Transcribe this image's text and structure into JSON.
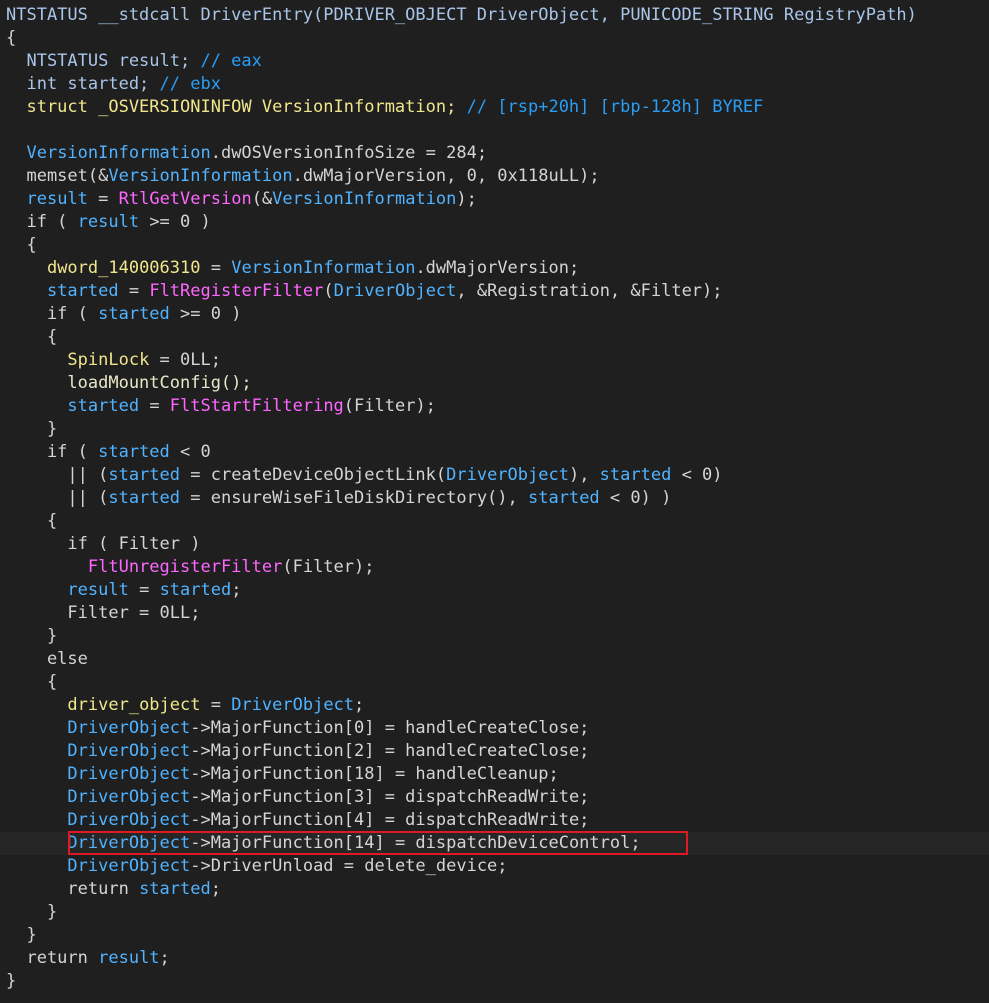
{
  "colors": {
    "background": "#1f1f1f",
    "current_line": "#262626",
    "highlight_border": "#e01a22",
    "default": "#d4d4d4",
    "type": "#a9c5e8",
    "variable": "#51b3ff",
    "lvar": "#f0e68c",
    "import": "#ff66ff",
    "comment": "#2a9df4",
    "function": "#e8e8c8"
  },
  "code": {
    "lines": [
      [
        [
          "NTSTATUS __stdcall DriverEntry(PDRIVER_OBJECT DriverObject, PUNICODE_STRING RegistryPath)",
          "type"
        ]
      ],
      [
        [
          "{",
          "default"
        ]
      ],
      [
        [
          "  NTSTATUS result; ",
          "type"
        ],
        [
          "// eax",
          "comment"
        ]
      ],
      [
        [
          "  int started; ",
          "type"
        ],
        [
          "// ebx",
          "comment"
        ]
      ],
      [
        [
          "  struct _OSVERSIONINFOW VersionInformation; ",
          "lvar"
        ],
        [
          "// [rsp+20h] [rbp-128h] BYREF",
          "comment"
        ]
      ],
      [
        [
          "",
          "default"
        ]
      ],
      [
        [
          "  ",
          "default"
        ],
        [
          "VersionInformation",
          "variable"
        ],
        [
          ".dwOSVersionInfoSize = 284;",
          "default"
        ]
      ],
      [
        [
          "  memset(&",
          "default"
        ],
        [
          "VersionInformation",
          "variable"
        ],
        [
          ".dwMajorVersion, 0, 0x118uLL);",
          "default"
        ]
      ],
      [
        [
          "  ",
          "default"
        ],
        [
          "result",
          "variable"
        ],
        [
          " = ",
          "default"
        ],
        [
          "RtlGetVersion",
          "import"
        ],
        [
          "(&",
          "default"
        ],
        [
          "VersionInformation",
          "variable"
        ],
        [
          ");",
          "default"
        ]
      ],
      [
        [
          "  if ( ",
          "default"
        ],
        [
          "result",
          "variable"
        ],
        [
          " >= 0 )",
          "default"
        ]
      ],
      [
        [
          "  {",
          "default"
        ]
      ],
      [
        [
          "    ",
          "default"
        ],
        [
          "dword_140006310",
          "lvar"
        ],
        [
          " = ",
          "default"
        ],
        [
          "VersionInformation",
          "variable"
        ],
        [
          ".dwMajorVersion;",
          "default"
        ]
      ],
      [
        [
          "    ",
          "default"
        ],
        [
          "started",
          "variable"
        ],
        [
          " = ",
          "default"
        ],
        [
          "FltRegisterFilter",
          "import"
        ],
        [
          "(",
          "default"
        ],
        [
          "DriverObject",
          "variable"
        ],
        [
          ", &Registration, &Filter);",
          "default"
        ]
      ],
      [
        [
          "    if ( ",
          "default"
        ],
        [
          "started",
          "variable"
        ],
        [
          " >= 0 )",
          "default"
        ]
      ],
      [
        [
          "    {",
          "default"
        ]
      ],
      [
        [
          "      ",
          "default"
        ],
        [
          "SpinLock",
          "lvar"
        ],
        [
          " = 0LL;",
          "default"
        ]
      ],
      [
        [
          "      loadMountConfig();",
          "function"
        ]
      ],
      [
        [
          "      ",
          "default"
        ],
        [
          "started",
          "variable"
        ],
        [
          " = ",
          "default"
        ],
        [
          "FltStartFiltering",
          "import"
        ],
        [
          "(Filter);",
          "default"
        ]
      ],
      [
        [
          "    }",
          "default"
        ]
      ],
      [
        [
          "    if ( ",
          "default"
        ],
        [
          "started",
          "variable"
        ],
        [
          " < 0",
          "default"
        ]
      ],
      [
        [
          "      || (",
          "default"
        ],
        [
          "started",
          "variable"
        ],
        [
          " = createDeviceObjectLink(",
          "default"
        ],
        [
          "DriverObject",
          "variable"
        ],
        [
          "), ",
          "default"
        ],
        [
          "started",
          "variable"
        ],
        [
          " < 0)",
          "default"
        ]
      ],
      [
        [
          "      || (",
          "default"
        ],
        [
          "started",
          "variable"
        ],
        [
          " = ensureWiseFileDiskDirectory(), ",
          "default"
        ],
        [
          "started",
          "variable"
        ],
        [
          " < 0) )",
          "default"
        ]
      ],
      [
        [
          "    {",
          "default"
        ]
      ],
      [
        [
          "      if ( Filter )",
          "default"
        ]
      ],
      [
        [
          "        ",
          "default"
        ],
        [
          "FltUnregisterFilter",
          "import"
        ],
        [
          "(Filter);",
          "default"
        ]
      ],
      [
        [
          "      ",
          "default"
        ],
        [
          "result",
          "variable"
        ],
        [
          " = ",
          "default"
        ],
        [
          "started",
          "variable"
        ],
        [
          ";",
          "default"
        ]
      ],
      [
        [
          "      Filter = 0LL;",
          "default"
        ]
      ],
      [
        [
          "    }",
          "default"
        ]
      ],
      [
        [
          "    else",
          "default"
        ]
      ],
      [
        [
          "    {",
          "default"
        ]
      ],
      [
        [
          "      ",
          "default"
        ],
        [
          "driver_object",
          "lvar"
        ],
        [
          " = ",
          "default"
        ],
        [
          "DriverObject",
          "variable"
        ],
        [
          ";",
          "default"
        ]
      ],
      [
        [
          "      ",
          "default"
        ],
        [
          "DriverObject",
          "variable"
        ],
        [
          "->MajorFunction[0] = handleCreateClose;",
          "default"
        ]
      ],
      [
        [
          "      ",
          "default"
        ],
        [
          "DriverObject",
          "variable"
        ],
        [
          "->MajorFunction[2] = handleCreateClose;",
          "default"
        ]
      ],
      [
        [
          "      ",
          "default"
        ],
        [
          "DriverObject",
          "variable"
        ],
        [
          "->MajorFunction[18] = handleCleanup;",
          "default"
        ]
      ],
      [
        [
          "      ",
          "default"
        ],
        [
          "DriverObject",
          "variable"
        ],
        [
          "->MajorFunction[3] = dispatchReadWrite;",
          "default"
        ]
      ],
      [
        [
          "      ",
          "default"
        ],
        [
          "DriverObject",
          "variable"
        ],
        [
          "->MajorFunction[4] = dispatchReadWrite;",
          "default"
        ]
      ],
      [
        [
          "      ",
          "default"
        ],
        [
          "DriverObject",
          "variable"
        ],
        [
          "->MajorFunction[14] = dispatchDeviceControl;",
          "default"
        ]
      ],
      [
        [
          "      ",
          "default"
        ],
        [
          "DriverObject",
          "variable"
        ],
        [
          "->DriverUnload = delete_device;",
          "default"
        ]
      ],
      [
        [
          "      return ",
          "default"
        ],
        [
          "started",
          "variable"
        ],
        [
          ";",
          "default"
        ]
      ],
      [
        [
          "    }",
          "default"
        ]
      ],
      [
        [
          "  }",
          "default"
        ]
      ],
      [
        [
          "  return ",
          "default"
        ],
        [
          "result",
          "variable"
        ],
        [
          ";",
          "default"
        ]
      ],
      [
        [
          "}",
          "default"
        ]
      ]
    ]
  }
}
